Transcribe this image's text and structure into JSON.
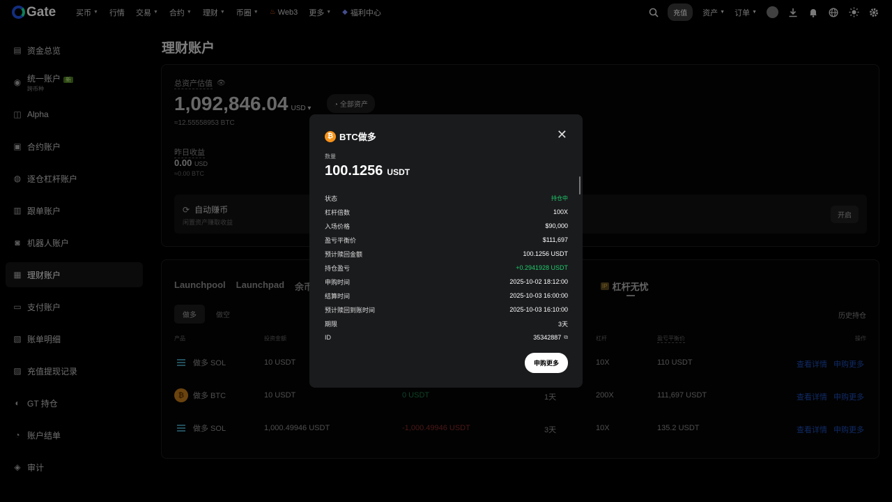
{
  "nav": {
    "logo": "Gate",
    "items": [
      {
        "label": "买币",
        "caret": true
      },
      {
        "label": "行情",
        "caret": false
      },
      {
        "label": "交易",
        "caret": true
      },
      {
        "label": "合约",
        "caret": true
      },
      {
        "label": "理财",
        "caret": true
      },
      {
        "label": "币圈",
        "caret": true
      },
      {
        "label": "Web3",
        "caret": false,
        "prefix": "fire-icon"
      },
      {
        "label": "更多",
        "caret": true
      },
      {
        "label": "福利中心",
        "caret": false,
        "prefix": "cube-icon"
      }
    ],
    "deposit": "充值",
    "assets": "资产",
    "orders": "订单"
  },
  "sidebar": {
    "items": [
      {
        "label": "资金总览",
        "icon": "wallet-icon"
      },
      {
        "label": "统一账户",
        "sub": "跨币种",
        "badge": "新",
        "icon": "unified-icon"
      },
      {
        "label": "Alpha",
        "icon": "alpha-icon"
      },
      {
        "label": "合约账户",
        "icon": "futures-icon"
      },
      {
        "label": "逐仓杠杆账户",
        "icon": "margin-icon"
      },
      {
        "label": "跟单账户",
        "icon": "copy-icon"
      },
      {
        "label": "机器人账户",
        "icon": "robot-icon"
      },
      {
        "label": "理财账户",
        "icon": "earn-icon",
        "active": true
      },
      {
        "label": "支付账户",
        "icon": "card-icon"
      },
      {
        "label": "账单明细",
        "icon": "bill-icon"
      },
      {
        "label": "充值提现记录",
        "icon": "record-icon"
      },
      {
        "label": "GT 持仓",
        "icon": "gt-icon"
      },
      {
        "label": "账户结单",
        "icon": "statement-icon"
      },
      {
        "label": "审计",
        "icon": "audit-icon"
      }
    ]
  },
  "page": {
    "title": "理财账户",
    "total_label": "总资产估值",
    "total_value": "1,092,846.04",
    "total_unit": "USD",
    "all_assets": "全部资产",
    "btc_equiv": "≈12.55558953 BTC",
    "yesterday_label": "昨日收益",
    "yesterday_value": "0.00",
    "yesterday_unit": "USD",
    "yesterday_sub": "≈0.00 BTC",
    "auto_title": "自动赚币",
    "auto_sub": "闲置资产赚取收益",
    "auto_btn": "开启"
  },
  "products": {
    "tabs": [
      "Launchpool",
      "Launchpad",
      "余币"
    ],
    "hot_badge": "IP",
    "active_tab": "杠杆无忧",
    "sub_tabs": [
      "做多",
      "做空"
    ],
    "history": "历史持仓",
    "headers": {
      "product": "产品",
      "invest": "投资金额",
      "leverage": "杠杆",
      "breakeven": "盈亏平衡价",
      "action": "操作"
    },
    "rows": [
      {
        "coin": "sol",
        "name": "做多 SOL",
        "invest": "10 USDT",
        "pnl": "",
        "term": "",
        "lev": "10X",
        "breakeven": "110 USDT",
        "view": "查看详情",
        "more": "申购更多"
      },
      {
        "coin": "btc",
        "name": "做多 BTC",
        "invest": "10 USDT",
        "pnl": "0 USDT",
        "term": "1天",
        "lev": "200X",
        "breakeven": "111,697 USDT",
        "view": "查看详情",
        "more": "申购更多"
      },
      {
        "coin": "sol",
        "name": "做多 SOL",
        "invest": "1,000.49946 USDT",
        "pnl": "-1,000.49946 USDT",
        "term": "3天",
        "lev": "10X",
        "breakeven": "135.2 USDT",
        "view": "查看详情",
        "more": "申购更多"
      }
    ]
  },
  "modal": {
    "title": "BTC做多",
    "coin_glyph": "₿",
    "qty_label": "数量",
    "qty_value": "100.1256",
    "qty_unit": "USDT",
    "rows": [
      {
        "k": "状态",
        "v": "持仓中"
      },
      {
        "k": "杠杆倍数",
        "v": "100X"
      },
      {
        "k": "入场价格",
        "v": "$90,000"
      },
      {
        "k": "盈亏平衡价",
        "v": "$111,697"
      },
      {
        "k": "预计赎回金额",
        "v": "100.1256 USDT"
      },
      {
        "k": "持仓盈亏",
        "v": "+0.2941928 USDT"
      },
      {
        "k": "申购时间",
        "v": "2025-10-02 18:12:00"
      },
      {
        "k": "结算时间",
        "v": "2025-10-03 16:00:00"
      },
      {
        "k": "预计赎回到账时间",
        "v": "2025-10-03 16:10:00"
      },
      {
        "k": "期限",
        "v": "3天"
      },
      {
        "k": "ID",
        "v": "35342887"
      }
    ],
    "button": "申购更多"
  },
  "colors": {
    "accent_green": "#1fcc6b",
    "link_blue": "#1e4db8",
    "btc_orange": "#f7931a"
  }
}
